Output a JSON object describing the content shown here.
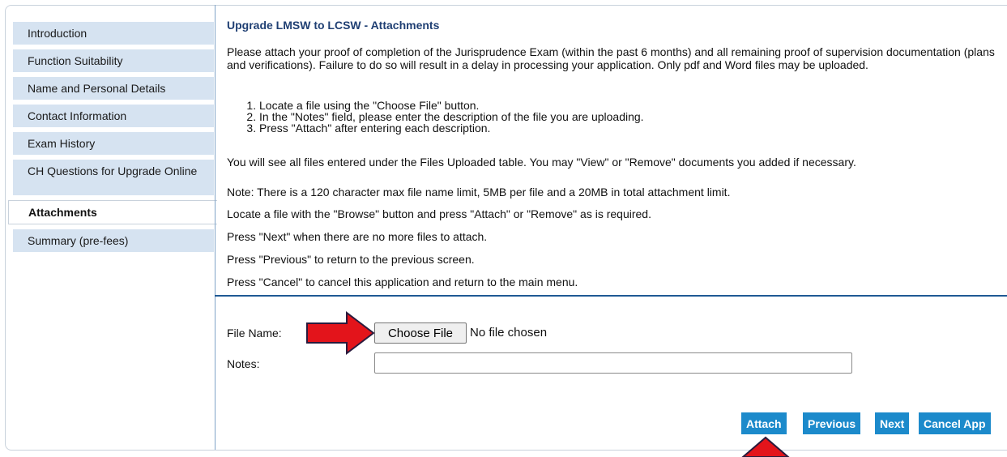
{
  "sidebar": {
    "items": [
      {
        "label": "Introduction"
      },
      {
        "label": "Function Suitability"
      },
      {
        "label": "Name and Personal Details"
      },
      {
        "label": "Contact Information"
      },
      {
        "label": "Exam History"
      },
      {
        "label": "CH Questions for Upgrade Online"
      },
      {
        "label": "Attachments",
        "active": true
      },
      {
        "label": "Summary (pre-fees)"
      }
    ]
  },
  "main": {
    "title": "Upgrade LMSW to LCSW - Attachments",
    "intro": "Please attach your proof of completion of the Jurisprudence Exam (within the past 6 months) and all remaining proof of supervision documentation (plans and verifications). Failure to do so will result in a delay in processing your application. Only pdf and Word files may be uploaded.",
    "steps": [
      "Locate a file using the \"Choose File\" button.",
      "In the \"Notes\" field, please enter the description of the file you are uploading.",
      "Press \"Attach\" after entering each description."
    ],
    "paragraphs": [
      "You will see all files entered under the Files Uploaded table. You may \"View\" or \"Remove\" documents you added if necessary.",
      "Note: There is a 120 character max file name limit, 5MB per file and a 20MB in total attachment limit.",
      "Locate a file with the \"Browse\" button and press \"Attach\" or \"Remove\" as is required.",
      "Press \"Next\" when there are no more files to attach.",
      "Press \"Previous\" to return to the previous screen.",
      "Press \"Cancel\" to cancel this application and return to the main menu."
    ]
  },
  "form": {
    "file_name_label": "File Name:",
    "choose_file_label": "Choose File",
    "no_file_text": "No file chosen",
    "notes_label": "Notes:",
    "notes_value": ""
  },
  "buttons": {
    "attach": "Attach",
    "previous": "Previous",
    "next": "Next",
    "cancel": "Cancel App"
  },
  "colors": {
    "nav_bg": "#d6e3f1",
    "title": "#1f3f73",
    "button_bg": "#1c8acb",
    "arrow": "#e3141b"
  }
}
